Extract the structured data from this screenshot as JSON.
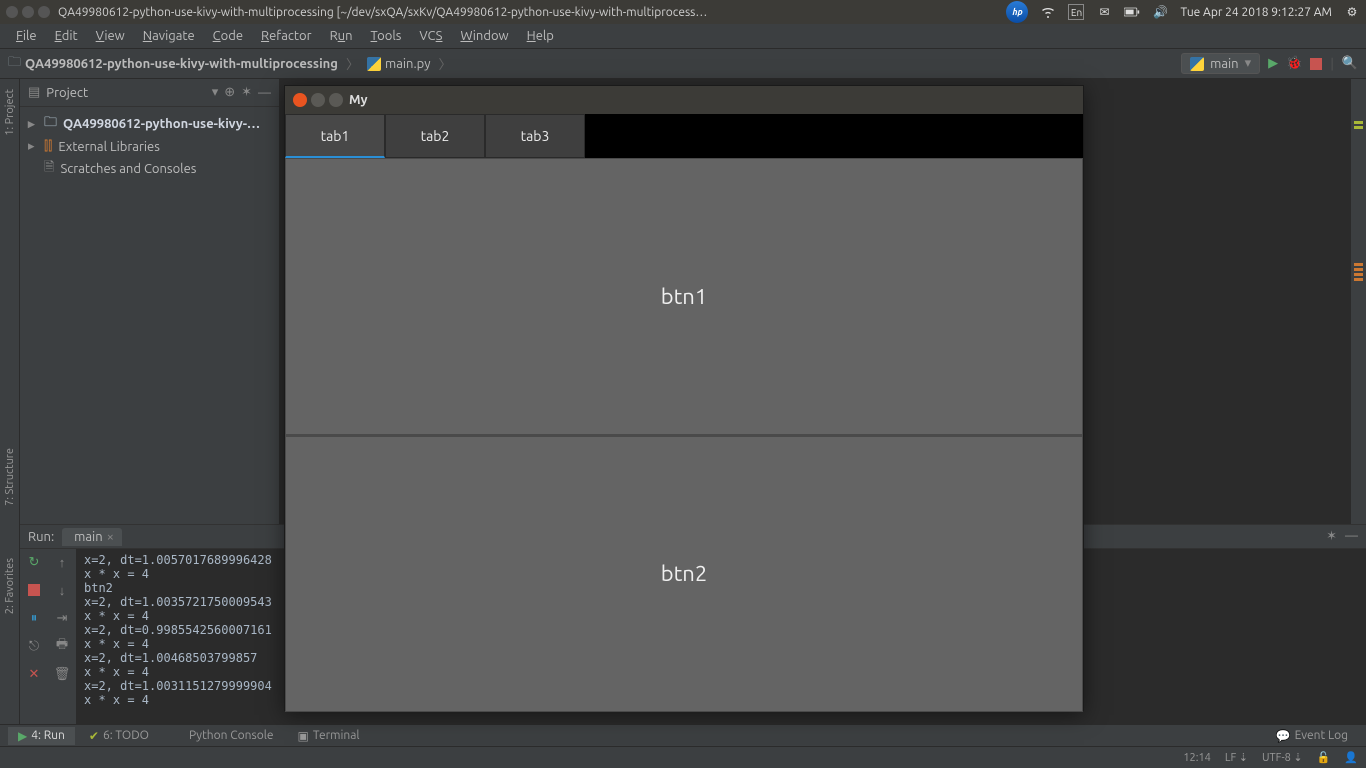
{
  "os": {
    "title": "QA49980612-python-use-kivy-with-multiprocessing [~/dev/sxQA/sxKv/QA49980612-python-use-kivy-with-multiprocess…",
    "hp": "hp",
    "lang": "En",
    "clock": "Tue Apr 24 2018  9:12:27 AM"
  },
  "menu": {
    "file": "File",
    "edit": "Edit",
    "view": "View",
    "navigate": "Navigate",
    "code": "Code",
    "refactor": "Refactor",
    "run": "Run",
    "tools": "Tools",
    "vcs": "VCS",
    "window": "Window",
    "help": "Help"
  },
  "breadcrumb": {
    "project": "QA49980612-python-use-kivy-with-multiprocessing",
    "file": "main.py"
  },
  "runconfig": {
    "name": "main"
  },
  "sidebar": {
    "title": "Project",
    "root": "QA49980612-python-use-kivy-…",
    "ext": "External Libraries",
    "scratch": "Scratches and Consoles"
  },
  "left_tabs": {
    "project": "1: Project",
    "structure": "7: Structure",
    "favorites": "2: Favorites"
  },
  "runtool": {
    "label": "Run:",
    "tab": "main",
    "lines": [
      "x=2, dt=1.0057017689996428",
      "x * x = 4",
      "btn2",
      "x=2, dt=1.0035721750009543",
      "x * x = 4",
      "x=2, dt=0.9985542560007161",
      "x * x = 4",
      "x=2, dt=1.00468503799857",
      "x * x = 4",
      "x=2, dt=1.0031151279999904",
      "x * x = 4"
    ]
  },
  "bottom": {
    "run": "4: Run",
    "todo": "6: TODO",
    "pyconsole": "Python Console",
    "terminal": "Terminal",
    "eventlog": "Event Log"
  },
  "status": {
    "pos": "12:14",
    "sep": "LF",
    "enc": "UTF-8"
  },
  "kivy": {
    "title": "My",
    "tabs": [
      "tab1",
      "tab2",
      "tab3"
    ],
    "btn1": "btn1",
    "btn2": "btn2"
  }
}
